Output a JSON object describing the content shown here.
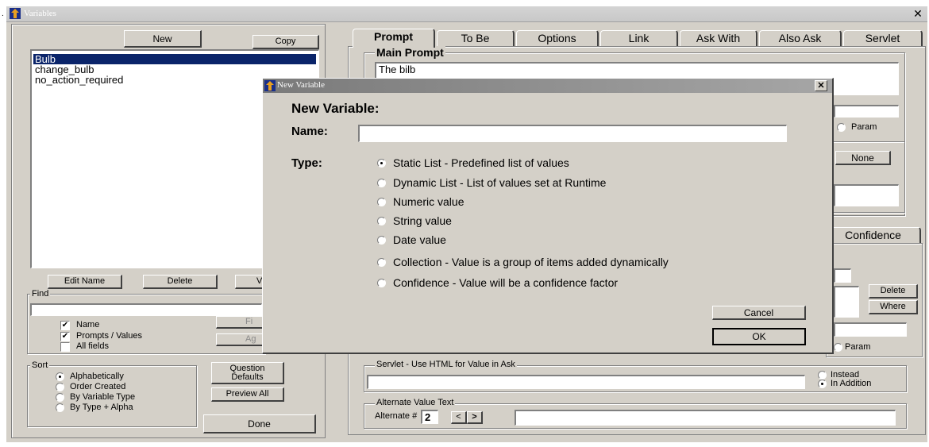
{
  "window": {
    "title": "Variables"
  },
  "left": {
    "new_label": "New",
    "copy_label": "Copy",
    "variables": [
      "Bulb",
      "change_bulb",
      "no_action_required"
    ],
    "edit_name_label": "Edit Name",
    "delete_label": "Delete",
    "v_partial_label": "V",
    "find": {
      "label": "Find",
      "value": "",
      "name_label": "Name",
      "prompts_label": "Prompts / Values",
      "allfields_label": "All fields",
      "find_btn_partial": "Fi",
      "again_btn_partial": "Ag"
    },
    "sort": {
      "label": "Sort",
      "options": [
        "Alphabetically",
        "Order Created",
        "By Variable Type",
        "By Type + Alpha"
      ],
      "selected": "Alphabetically"
    },
    "question_defaults_label": "Question Defaults",
    "preview_all_label": "Preview All",
    "done_label": "Done"
  },
  "right": {
    "tabs": [
      "Prompt",
      "To Be",
      "Options",
      "Link",
      "Ask With",
      "Also Ask",
      "Servlet"
    ],
    "active_tab": "Prompt",
    "main_prompt_label": "Main Prompt",
    "main_prompt_value": "The bilb",
    "param_label": "Param",
    "none_label": "None",
    "confidence_tab_partial": "Confidence",
    "delete_label": "Delete",
    "where_label": "Where",
    "param2_label": "Param",
    "servlet_label": "Servlet - Use HTML for Value in Ask",
    "servlet_value": "",
    "instead_label": "Instead",
    "in_addition_label": "In Addition",
    "alternate_label": "Alternate Value Text",
    "alternate_num_label": "Alternate #",
    "alternate_num": "2",
    "prev_symbol": "<",
    "next_symbol": ">",
    "alternate_value": ""
  },
  "dialog": {
    "title": "New Variable",
    "heading": "New Variable:",
    "name_label": "Name:",
    "name_value": "",
    "type_label": "Type:",
    "types": [
      "Static List - Predefined list of values",
      "Dynamic List - List of values set at Runtime",
      "Numeric value",
      "String value",
      "Date value",
      "Collection - Value is a group of items added dynamically",
      "Confidence - Value will be a confidence factor"
    ],
    "selected_type": "Static List - Predefined list of values",
    "cancel_label": "Cancel",
    "ok_label": "OK"
  }
}
